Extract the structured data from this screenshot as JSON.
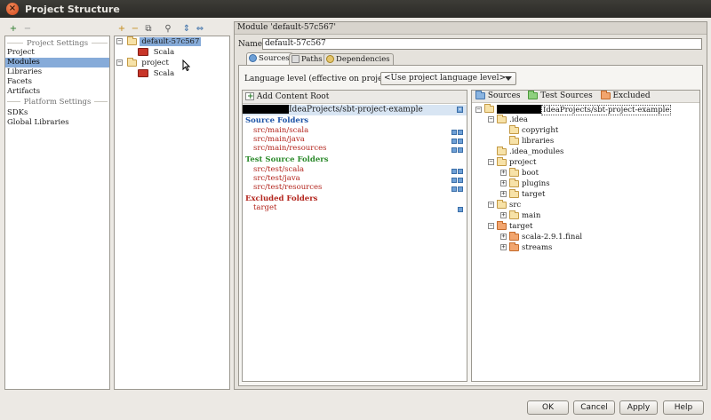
{
  "window": {
    "title": "Project Structure",
    "close_glyph": "×"
  },
  "toolbar": {
    "add_glyph": "+",
    "remove_glyph": "−",
    "add_module_glyph": "+",
    "remove_module_glyph": "−",
    "copy_glyph": "⧉",
    "find_glyph": "⚲",
    "expand_glyph": "⇕",
    "collapse_glyph": "⇔"
  },
  "nav": {
    "project_settings_header": "Project Settings",
    "project_items": [
      "Project",
      "Modules",
      "Libraries",
      "Facets",
      "Artifacts"
    ],
    "platform_settings_header": "Platform Settings",
    "platform_items": [
      "SDKs",
      "Global Libraries"
    ]
  },
  "module_tree": [
    {
      "label": "default-57c567",
      "type": "module",
      "expander": "−",
      "selected": true
    },
    {
      "label": "Scala",
      "type": "facet"
    },
    {
      "label": "project",
      "type": "module",
      "expander": "−"
    },
    {
      "label": "Scala",
      "type": "facet"
    }
  ],
  "module": {
    "header": "Module 'default-57c567'",
    "name_label": "Name:",
    "name_value": "default-57c567",
    "tabs": [
      "Sources",
      "Paths",
      "Dependencies"
    ],
    "language_level_label": "Language level (effective on project reload):",
    "language_level_value": "<Use project language level>"
  },
  "content_root": {
    "add_label": "Add Content Root",
    "root_path": "IdeaProjects/sbt-project-example",
    "source_folders_header": "Source Folders",
    "source_folders": [
      "src/main/scala",
      "src/main/java",
      "src/main/resources"
    ],
    "test_folders_header": "Test Source Folders",
    "test_folders": [
      "src/test/scala",
      "src/test/java",
      "src/test/resources"
    ],
    "excluded_header": "Excluded Folders",
    "excluded_folders": [
      "target"
    ]
  },
  "mark_as": {
    "sources": "Sources",
    "test_sources": "Test Sources",
    "excluded": "Excluded"
  },
  "folder_tree": [
    {
      "label": "IdeaProjects/sbt-project-example",
      "depth": 0,
      "exp": "−",
      "kind": "plain"
    },
    {
      "label": ".idea",
      "depth": 1,
      "exp": "−",
      "kind": "plain"
    },
    {
      "label": "copyright",
      "depth": 2,
      "exp": "",
      "kind": "plain"
    },
    {
      "label": "libraries",
      "depth": 2,
      "exp": "",
      "kind": "plain"
    },
    {
      "label": ".idea_modules",
      "depth": 1,
      "exp": "",
      "kind": "plain"
    },
    {
      "label": "project",
      "depth": 1,
      "exp": "−",
      "kind": "plain"
    },
    {
      "label": "boot",
      "depth": 2,
      "exp": "+",
      "kind": "plain"
    },
    {
      "label": "plugins",
      "depth": 2,
      "exp": "+",
      "kind": "plain"
    },
    {
      "label": "target",
      "depth": 2,
      "exp": "+",
      "kind": "plain"
    },
    {
      "label": "src",
      "depth": 1,
      "exp": "−",
      "kind": "plain"
    },
    {
      "label": "main",
      "depth": 2,
      "exp": "+",
      "kind": "plain"
    },
    {
      "label": "target",
      "depth": 1,
      "exp": "−",
      "kind": "orange"
    },
    {
      "label": "scala-2.9.1.final",
      "depth": 2,
      "exp": "+",
      "kind": "orange"
    },
    {
      "label": "streams",
      "depth": 2,
      "exp": "+",
      "kind": "orange"
    }
  ],
  "buttons": {
    "ok": "OK",
    "cancel": "Cancel",
    "apply": "Apply",
    "help": "Help"
  }
}
